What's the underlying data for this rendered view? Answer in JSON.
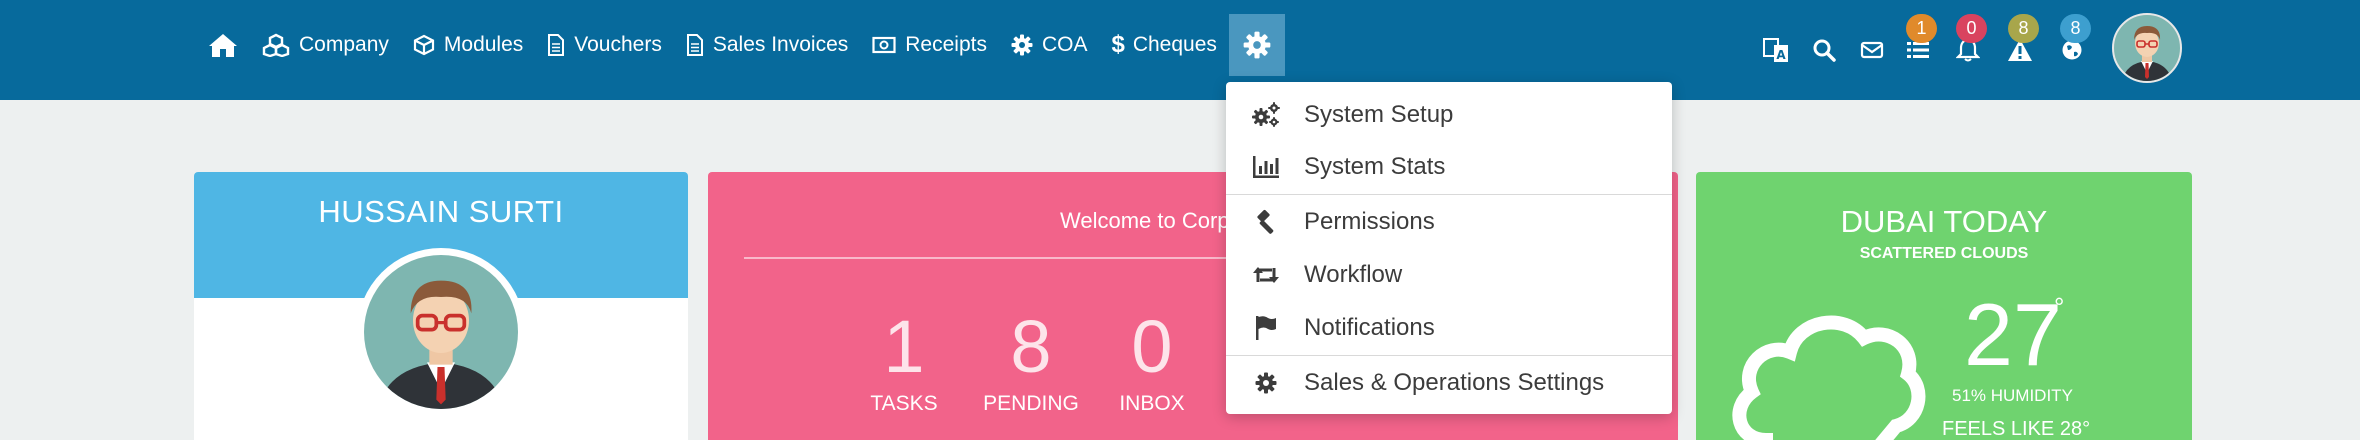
{
  "nav": {
    "items": [
      {
        "label": "Company",
        "icon": "cubes-icon"
      },
      {
        "label": "Modules",
        "icon": "cube-icon"
      },
      {
        "label": "Vouchers",
        "icon": "document-icon"
      },
      {
        "label": "Sales Invoices",
        "icon": "document-icon"
      },
      {
        "label": "Receipts",
        "icon": "money-icon"
      },
      {
        "label": "COA",
        "icon": "gear-icon"
      },
      {
        "label": "Cheques",
        "icon": "dollar-icon"
      }
    ],
    "home_icon": "home-icon",
    "settings_icon": "gear-icon"
  },
  "header_icons": {
    "badges": {
      "tasks": "1",
      "notifications": "0",
      "alerts": "8",
      "global": "8"
    },
    "badge_colors": {
      "tasks": "#e08a2b",
      "notifications": "#d9435f",
      "alerts": "#a8a64b",
      "global": "#3d9fcf"
    }
  },
  "dropdown": {
    "items": [
      {
        "label": "System Setup",
        "icon": "gears-icon"
      },
      {
        "label": "System Stats",
        "icon": "bar-chart-icon"
      },
      {
        "label": "Permissions",
        "icon": "gavel-icon"
      },
      {
        "label": "Workflow",
        "icon": "retweet-icon"
      },
      {
        "label": "Notifications",
        "icon": "flag-icon"
      },
      {
        "label": "Sales & Operations Settings",
        "icon": "gear-icon"
      }
    ]
  },
  "profile": {
    "name": "HUSSAIN SURTI"
  },
  "welcome": {
    "text": "Welcome to Corp",
    "stats": [
      {
        "value": "1",
        "label": "TASKS"
      },
      {
        "value": "8",
        "label": "PENDING"
      },
      {
        "value": "0",
        "label": "INBOX"
      }
    ]
  },
  "weather": {
    "city": "DUBAI TODAY",
    "description": "SCATTERED CLOUDS",
    "temperature": "27",
    "degree_symbol": "°",
    "humidity": "51% HUMIDITY",
    "feels_like": "FEELS LIKE 28°"
  },
  "colors": {
    "navbar": "#076a9c",
    "active_tab": "#4a97bf",
    "profile_header": "#4fb6e4",
    "welcome_card": "#f2638a",
    "weather_card": "#6fd36f"
  }
}
